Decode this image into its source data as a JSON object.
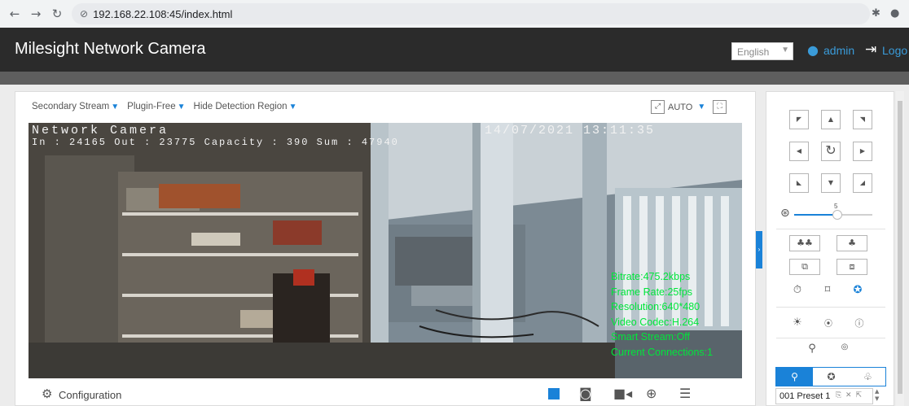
{
  "browser": {
    "url": "192.168.22.108:45/index.html",
    "back_icon": "arrow-left-icon",
    "forward_icon": "arrow-right-icon",
    "reload_icon": "reload-icon"
  },
  "header": {
    "title": "Milesight Network Camera",
    "language": "English",
    "user": "admin",
    "logout": "Logo"
  },
  "stream_toolbar": {
    "stream": "Secondary Stream",
    "plugin": "Plugin-Free",
    "detection": "Hide Detection Region",
    "auto": "AUTO"
  },
  "video": {
    "overlay_title": "Network Camera",
    "counting": "In : 24165  Out : 23775  Capacity : 390  Sum : 47940",
    "timestamp": "14/07/2021  13:11:35",
    "stats": {
      "bitrate": "Bitrate:475.2kbps",
      "frame_rate": "Frame Rate:25fps",
      "resolution": "Resolution:640*480",
      "codec": "Video Codec:H.264",
      "smart_stream": "Smart Stream:Off",
      "connections": "Current Connections:1"
    }
  },
  "bottom_toolbar": {
    "configuration": "Configuration"
  },
  "ptz": {
    "speed_value": "5",
    "speed_fraction": 0.55,
    "presets_tab_icon": "pin-icon",
    "patrol_tab_icon": "patrol-icon",
    "pattern_tab_icon": "pattern-icon",
    "preset_row": "001 Preset 1"
  },
  "colors": {
    "accent": "#1a82d8",
    "header": "#2b2b2b",
    "stats_text": "#00e63b"
  }
}
